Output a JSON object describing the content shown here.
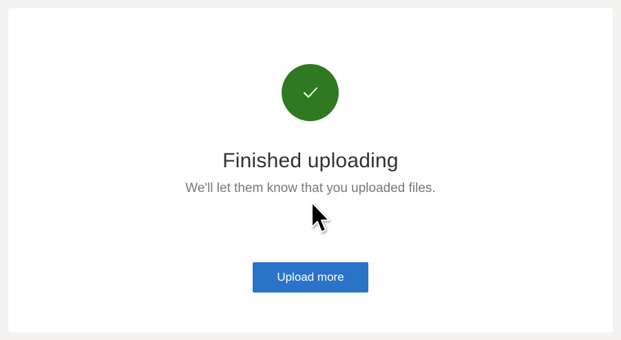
{
  "status": {
    "icon": "checkmark-icon",
    "color": "#2f7a20",
    "title": "Finished uploading",
    "message": "We'll let them know that you uploaded files."
  },
  "actions": {
    "upload_more_label": "Upload more",
    "primary_color": "#2b72c9"
  },
  "cursor": {
    "icon": "mouse-pointer-icon"
  }
}
